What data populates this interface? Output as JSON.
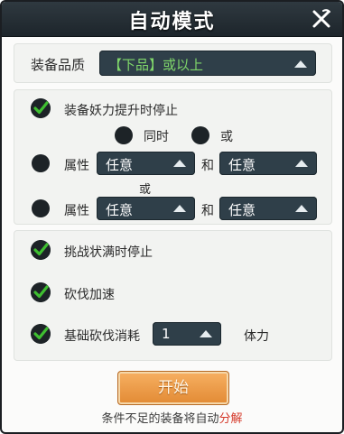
{
  "header": {
    "title": "自动模式"
  },
  "quality": {
    "label": "装备品质",
    "value_part1": "【下品】",
    "value_part2": "或以上"
  },
  "stop_section": {
    "stop_on_power_up": {
      "label": "装备妖力提升时停止",
      "checked": true
    },
    "radio_same_time": {
      "label": "同时",
      "selected": false
    },
    "radio_or": {
      "label": "或",
      "selected": false
    },
    "row1": {
      "label": "属性",
      "attr1": "任意",
      "and_label": "和",
      "attr2": "任意",
      "selected": false
    },
    "or_label": "或",
    "row2": {
      "label": "属性",
      "attr1": "任意",
      "and_label": "和",
      "attr2": "任意",
      "selected": false
    }
  },
  "options": {
    "stop_on_full_challenge": {
      "label": "挑战状满时停止",
      "checked": true
    },
    "chop_speedup": {
      "label": "砍伐加速",
      "checked": true
    },
    "base_chop_cost": {
      "label": "基础砍伐消耗",
      "checked": true,
      "value": "1",
      "unit": "体力"
    }
  },
  "start_button": {
    "label": "开始"
  },
  "footer": {
    "text_main": "条件不足的装备将自动",
    "text_highlight": "分解"
  },
  "colors": {
    "header_bg": "#2a343a",
    "dropdown_bg": "#2f3f49",
    "check_green": "#3fbf31",
    "start_orange": "#f0a050",
    "highlight_red": "#d53a2b"
  }
}
